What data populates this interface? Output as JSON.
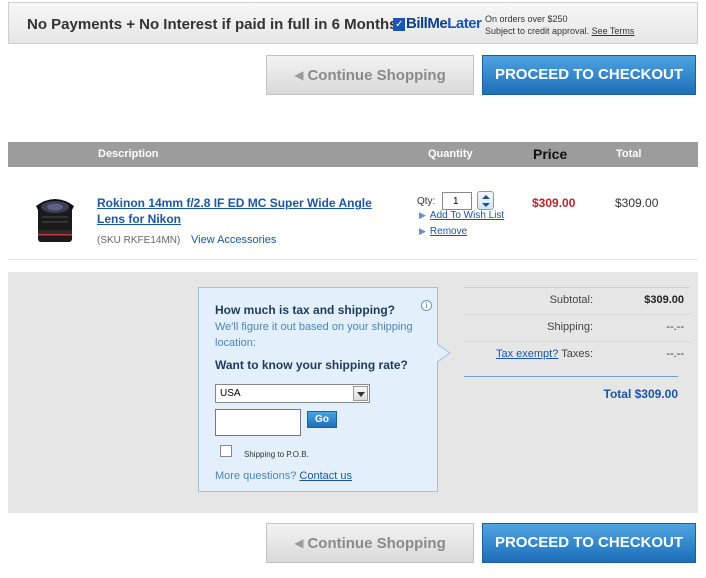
{
  "promo": {
    "text": "No Payments + No Interest if paid in full in 6 Months",
    "logo_part1": "Bill",
    "logo_part2": "Me",
    "logo_part3": "Later",
    "note_line1": "On orders over $250",
    "note_line2": "Subject to credit approval.",
    "terms_link": "See Terms"
  },
  "actions": {
    "continue_label": "Continue Shopping",
    "checkout_label": "PROCEED TO CHECKOUT"
  },
  "table": {
    "headers": {
      "description": "Description",
      "quantity": "Quantity",
      "price": "Price",
      "total": "Total"
    }
  },
  "item": {
    "title": "Rokinon 14mm f/2.8 IF ED MC Super Wide Angle Lens for Nikon",
    "sku": "(SKU RKFE14MN)",
    "accessories_link": "View Accessories",
    "qty_label": "Qty:",
    "qty_value": "1",
    "wishlist_link": "Add To Wish List",
    "remove_link": "Remove",
    "price": "$309.00",
    "total": "$309.00"
  },
  "shipping_calc": {
    "title": "How much is tax and shipping?",
    "subtitle": "We'll figure it out based on your shipping location:",
    "question": "Want to know your shipping rate?",
    "country_selected": "USA",
    "go_label": "Go",
    "pob_label": "Shipping to P.O.B.",
    "more_text": "More questions?",
    "contact_link": "Contact us"
  },
  "summary": {
    "subtotal_label": "Subtotal:",
    "subtotal_value": "$309.00",
    "shipping_label": "Shipping:",
    "shipping_value": "--.--",
    "tax_exempt_link": "Tax exempt?",
    "taxes_label": "Taxes:",
    "taxes_value": "--.--",
    "total_label": "Total $309.00"
  },
  "colors": {
    "checkout_blue": "#1c6fb8",
    "price_red": "#c0202a",
    "link_blue": "#1a56a8"
  }
}
